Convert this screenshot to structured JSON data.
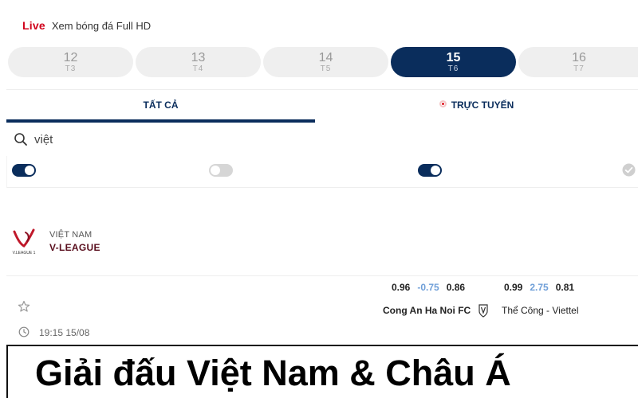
{
  "header": {
    "live_label": "Live",
    "tagline": "Xem bóng đá Full HD",
    "live_color": "#d0021b"
  },
  "days": [
    {
      "num": "12",
      "weekday": "T3",
      "active": false
    },
    {
      "num": "13",
      "weekday": "T4",
      "active": false
    },
    {
      "num": "14",
      "weekday": "T5",
      "active": false
    },
    {
      "num": "15",
      "weekday": "T6",
      "active": true
    },
    {
      "num": "16",
      "weekday": "T7",
      "active": false
    }
  ],
  "tabs": {
    "all": "TẤT CẢ",
    "online": "TRỰC TUYẾN"
  },
  "search": {
    "value": "việt",
    "icon": "search-icon"
  },
  "toggles": [
    {
      "state": "on"
    },
    {
      "state": "off"
    },
    {
      "state": "on"
    }
  ],
  "league": {
    "country": "VIỆT NAM",
    "name": "V-LEAGUE",
    "logo_text": "V.LEAGUE 1"
  },
  "match": {
    "home_odds": [
      "0.96",
      "-0.75",
      "0.86"
    ],
    "away_odds": [
      "0.99",
      "2.75",
      "0.81"
    ],
    "home_team": "Cong An Ha Noi FC",
    "away_team": "Thể Công - Viettel",
    "time": "19:15 15/08"
  },
  "banner": {
    "text": "Giải đấu Việt Nam & Châu Á"
  },
  "colors": {
    "navy": "#0a2d5c",
    "handicap": "#6f9fd8",
    "league_name": "#5a0f1e"
  }
}
